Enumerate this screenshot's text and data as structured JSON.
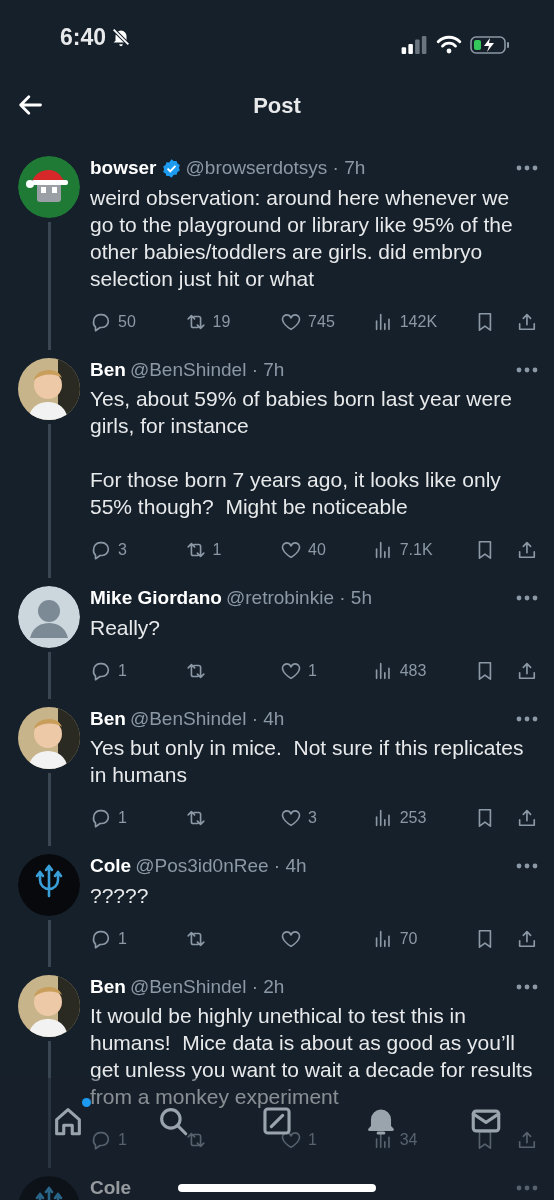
{
  "status_bar": {
    "time": "6:40",
    "silent": true,
    "charging": true
  },
  "header": {
    "title": "Post"
  },
  "posts": [
    {
      "avatar": {
        "kind": "cartoon"
      },
      "name": "bowser",
      "verified": true,
      "byline": "@browserdotsys · 7h",
      "text": "weird observation: around here whenever we go to the playground or library like 95% of the other babies/toddlers are girls. did embryo selection just hit or what",
      "replies": "50",
      "reposts": "19",
      "likes": "745",
      "views": "142K",
      "thread_line": true
    },
    {
      "name": "Ben",
      "verified": false,
      "byline": "@BenShindel · 7h",
      "text": "Yes, about 59% of babies born last year were girls, for instance\n\nFor those born 7 years ago, it looks like only 55% though?  Might be noticeable",
      "replies": "3",
      "reposts": "1",
      "likes": "40",
      "views": "7.1K",
      "thread_line": true
    },
    {
      "avatar": {
        "kind": "default"
      },
      "name": "Mike Giordano",
      "verified": false,
      "byline": "@retrobinkie · 5h",
      "text": "Really?",
      "replies": "1",
      "likes": "1",
      "views": "483",
      "thread_line": true
    },
    {
      "name": "Ben",
      "verified": false,
      "byline": "@BenShindel · 4h",
      "text": "Yes but only in mice.  Not sure if this replicates in humans",
      "replies": "1",
      "likes": "3",
      "views": "253",
      "thread_line": true
    },
    {
      "avatar": {
        "kind": "logo"
      },
      "name": "Cole",
      "verified": false,
      "byline": "@Pos3id0nRee · 4h",
      "text": "?????",
      "replies": "1",
      "views": "70",
      "thread_line": true
    },
    {
      "name": "Ben",
      "verified": false,
      "byline": "@BenShindel · 2h",
      "text": "It would be highly unethical to test this in humans!  Mice data is about as good as you’ll get unless you want to wait a decade for results from a monkey experiment",
      "replies": "1",
      "likes": "1",
      "views": "34",
      "thread_line": true
    },
    {
      "avatar": {
        "kind": "logo"
      },
      "name": "Cole",
      "verified": false
    }
  ],
  "bottom_nav": [
    {
      "kind": "home",
      "dot": true
    },
    {
      "kind": "search",
      "dot": false
    },
    {
      "kind": "grok",
      "dot": false
    },
    {
      "kind": "notifications",
      "dot": false
    },
    {
      "kind": "messages",
      "dot": false
    }
  ]
}
